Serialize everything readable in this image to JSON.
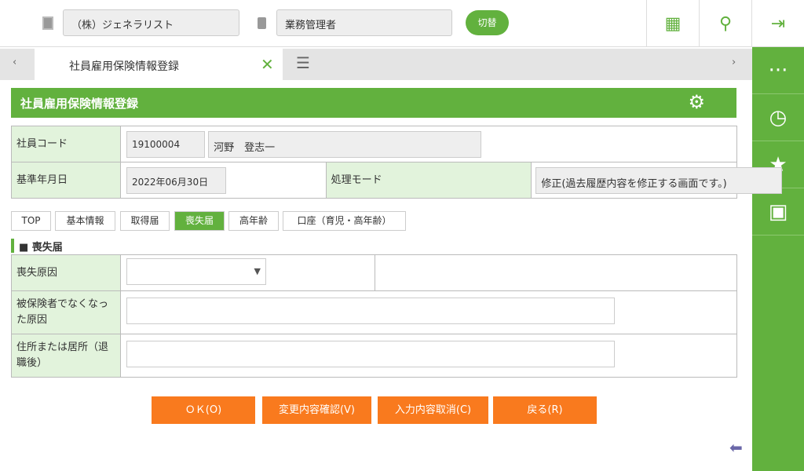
{
  "header": {
    "company": "（株）ジェネラリスト",
    "role": "業務管理者",
    "switch_label": "切替"
  },
  "tabs": {
    "active_label": "社員雇用保険情報登録"
  },
  "page": {
    "title": "社員雇用保険情報登録"
  },
  "info": {
    "employee_code_label": "社員コード",
    "employee_code": "19100004",
    "employee_name": "河野　登志一",
    "base_date_label": "基準年月日",
    "base_date": "2022年06月30日",
    "mode_label": "処理モード",
    "mode_value": "修正(過去履歴内容を修正する画面です。)"
  },
  "subtabs": [
    "TOP",
    "基本情報",
    "取得届",
    "喪失届",
    "高年齢",
    "口座（育児・高年齢）"
  ],
  "section": {
    "title": "■ 喪失届",
    "loss_reason_label": "喪失原因",
    "loss_reason_value": "",
    "not_insured_label": "被保険者でなくなった原因",
    "address_label": "住所または居所（退職後）"
  },
  "buttons": {
    "ok": "ＯＫ(O)",
    "confirm": "変更内容確認(V)",
    "cancel": "入力内容取消(C)",
    "back": "戻る(R)"
  },
  "colors": {
    "accent": "#62b13e",
    "button": "#f97a1e"
  }
}
